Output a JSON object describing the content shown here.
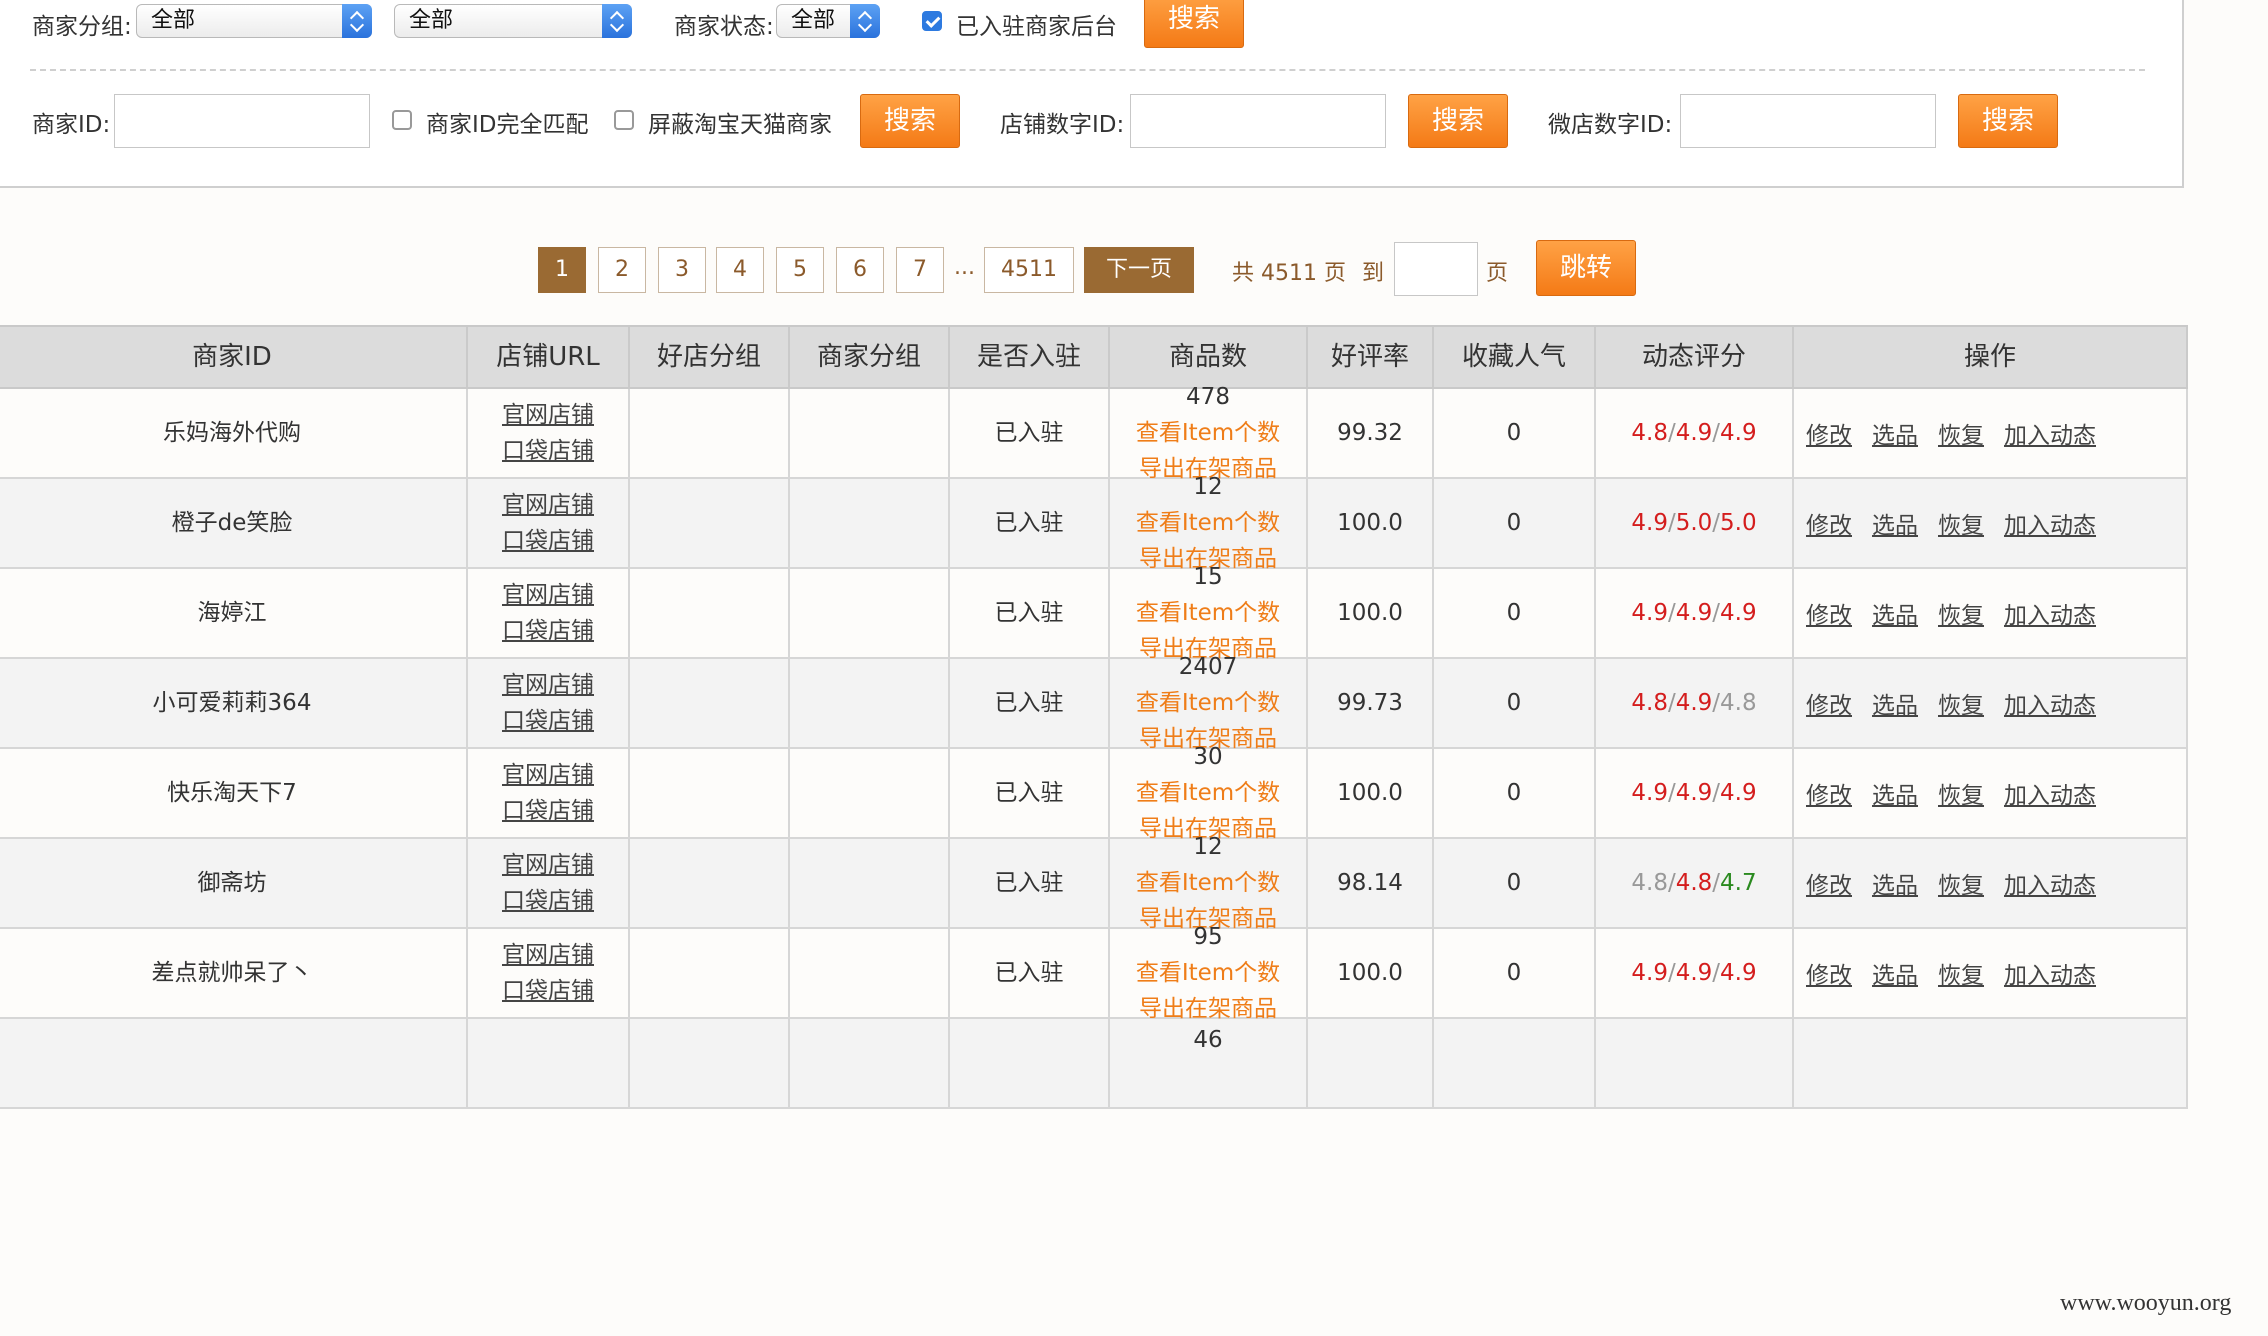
{
  "filters": {
    "group_label": "商家分组:",
    "group_select": "全部",
    "group_select2": "全部",
    "status_label": "商家状态:",
    "status_select": "全部",
    "joined_checkbox": "已入驻商家后台",
    "search": "搜索",
    "merchant_id_label": "商家ID:",
    "exact_match": "商家ID完全匹配",
    "hide_taobao": "屏蔽淘宝天猫商家",
    "shop_id_label": "店铺数字ID:",
    "weidian_id_label": "微店数字ID:"
  },
  "pagination": {
    "pages": [
      "1",
      "2",
      "3",
      "4",
      "5",
      "6",
      "7"
    ],
    "ellipsis": "...",
    "last": "4511",
    "next": "下一页",
    "total": "共 4511 页",
    "to": "到",
    "page_unit": "页",
    "jump": "跳转"
  },
  "table": {
    "headers": [
      "商家ID",
      "店铺URL",
      "好店分组",
      "商家分组",
      "是否入驻",
      "商品数",
      "好评率",
      "收藏人气",
      "动态评分",
      "操作"
    ],
    "official_shop": "官网店铺",
    "pocket_shop": "口袋店铺",
    "view_items": "查看Item个数",
    "export_items": "导出在架商品",
    "ops": [
      "修改",
      "选品",
      "恢复",
      "加入动态"
    ],
    "rows": [
      {
        "name": "乐妈海外代购",
        "joined": "已入驻",
        "count": "478",
        "rate": "99.32",
        "fav": "0",
        "s1": "4.8",
        "s2": "4.9",
        "s3": "4.9"
      },
      {
        "name": "橙子de笑脸",
        "joined": "已入驻",
        "count": "12",
        "rate": "100.0",
        "fav": "0",
        "s1": "4.9",
        "s2": "5.0",
        "s3": "5.0"
      },
      {
        "name": "海婷江",
        "joined": "已入驻",
        "count": "15",
        "rate": "100.0",
        "fav": "0",
        "s1": "4.9",
        "s2": "4.9",
        "s3": "4.9"
      },
      {
        "name": "小可爱莉莉364",
        "joined": "已入驻",
        "count": "2407",
        "rate": "99.73",
        "fav": "0",
        "s1": "4.8",
        "s2": "4.9",
        "s3": "4.8"
      },
      {
        "name": "快乐淘天下7",
        "joined": "已入驻",
        "count": "30",
        "rate": "100.0",
        "fav": "0",
        "s1": "4.9",
        "s2": "4.9",
        "s3": "4.9"
      },
      {
        "name": "御斋坊",
        "joined": "已入驻",
        "count": "12",
        "rate": "98.14",
        "fav": "0",
        "s1": "4.8",
        "s2": "4.8",
        "s3": "4.7"
      },
      {
        "name": "差点就帅呆了丶",
        "joined": "已入驻",
        "count": "95",
        "rate": "100.0",
        "fav": "0",
        "s1": "4.9",
        "s2": "4.9",
        "s3": "4.9"
      },
      {
        "count": "46"
      }
    ]
  },
  "colors": {
    "accent": "#f47a16",
    "pager": "#9a6a33",
    "score_red": "#d41d1d",
    "score_gray": "#999999",
    "score_green": "#2a8a1f"
  },
  "watermark": "www.wooyun.org"
}
